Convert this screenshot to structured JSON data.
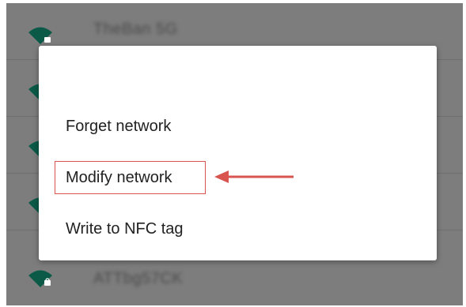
{
  "wifi_list": [
    {
      "name": "TheBan 5G",
      "icon": "wifi-lock-icon"
    },
    {
      "name": "",
      "icon": "wifi-icon"
    },
    {
      "name": "",
      "icon": "wifi-icon"
    },
    {
      "name": "",
      "icon": "wifi-icon"
    },
    {
      "name": "ATTbg57CK",
      "icon": "wifi-lock-icon"
    }
  ],
  "dialog": {
    "items": [
      {
        "label": "Forget network"
      },
      {
        "label": "Modify network"
      },
      {
        "label": "Write to NFC tag"
      }
    ]
  },
  "colors": {
    "accent": "#0b7a60",
    "highlight": "#d9534f",
    "overlay": "#7d7d7d"
  }
}
